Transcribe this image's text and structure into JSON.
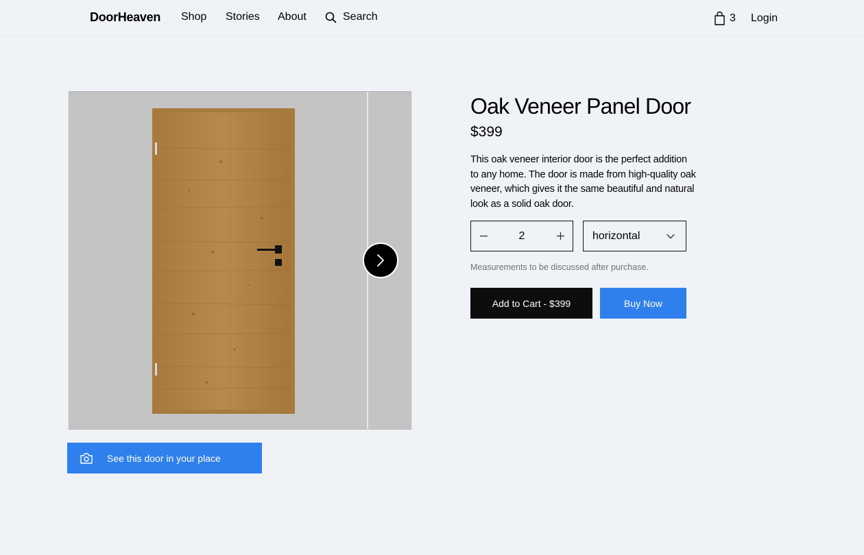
{
  "header": {
    "logo": "DoorHeaven",
    "nav": [
      {
        "label": "Shop"
      },
      {
        "label": "Stories"
      },
      {
        "label": "About"
      }
    ],
    "search_label": "Search",
    "cart_count": "3",
    "login_label": "Login"
  },
  "product": {
    "title": "Oak Veneer Panel Door",
    "price": "$399",
    "description": "This oak veneer interior door is the perfect addition to any home. The door is made from high-quality oak veneer, which gives it the same beautiful and natural look as a solid oak door.",
    "quantity": "2",
    "orientation": "horizontal",
    "note": "Measurements to be discussed after purchase.",
    "add_to_cart_label": "Add to Cart - $399",
    "buy_now_label": "Buy Now",
    "ar_label": "See this door in your place"
  },
  "colors": {
    "accent": "#2f80ed",
    "dark": "#0d0d0d",
    "background": "#eff2f7",
    "wood": "#b38446"
  },
  "icons": {
    "search": "search-icon",
    "cart": "shopping-bag-icon",
    "next": "chevron-right-icon",
    "minus": "minus-icon",
    "plus": "plus-icon",
    "dropdown": "chevron-down-icon",
    "camera": "camera-icon"
  }
}
